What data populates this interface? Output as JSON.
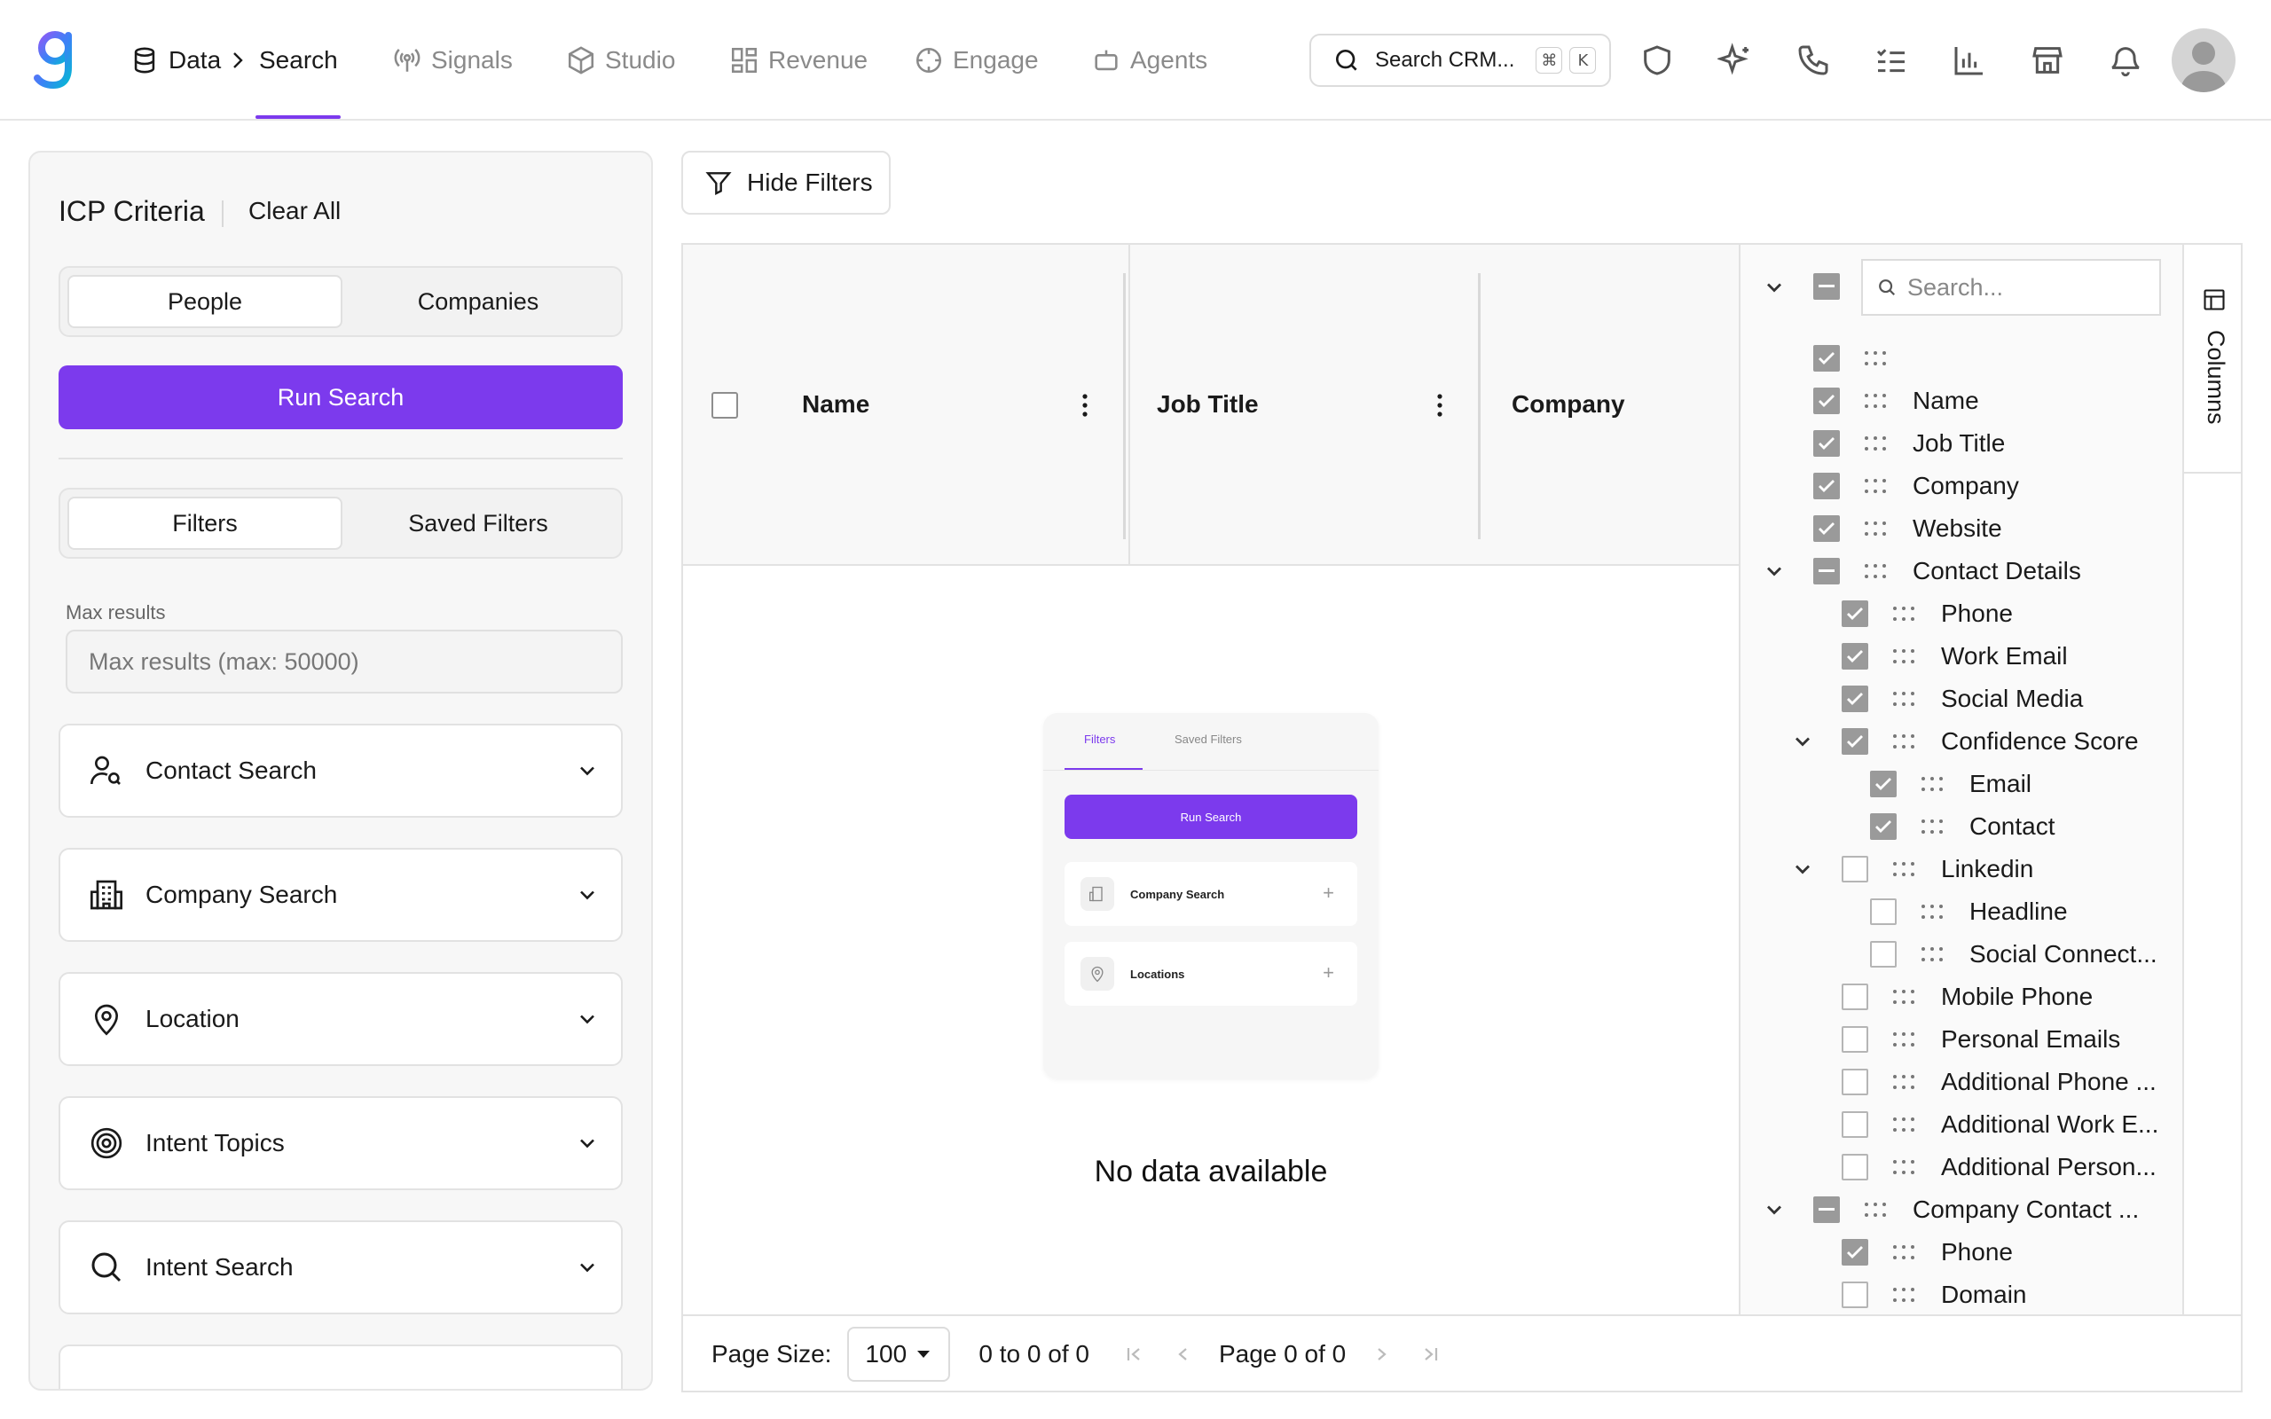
{
  "nav": {
    "data": "Data",
    "search": "Search",
    "signals": "Signals",
    "studio": "Studio",
    "revenue": "Revenue",
    "engage": "Engage",
    "agents": "Agents",
    "search_crm": "Search CRM...",
    "kbd_cmd": "⌘",
    "kbd_k": "K",
    "accent": "#7c3aed"
  },
  "left": {
    "title": "ICP Criteria",
    "clear_all": "Clear All",
    "tab_people": "People",
    "tab_companies": "Companies",
    "run_search": "Run Search",
    "tab_filters": "Filters",
    "tab_saved_filters": "Saved Filters",
    "max_results_label": "Max results",
    "max_results_placeholder": "Max results (max: 50000)",
    "sections": [
      "Contact Search",
      "Company Search",
      "Location",
      "Intent Topics",
      "Intent Search"
    ]
  },
  "main": {
    "hide_filters": "Hide Filters",
    "columns_head": [
      "Name",
      "Job Title",
      "Company"
    ],
    "no_data": "No data available",
    "illustration": {
      "tab_filters": "Filters",
      "tab_saved": "Saved Filters",
      "run": "Run Search",
      "card1": "Company Search",
      "card2": "Locations"
    },
    "pager": {
      "page_size_label": "Page Size:",
      "page_size": "100",
      "range": "0 to 0 of 0",
      "page": "Page 0 of 0"
    }
  },
  "columns_panel": {
    "tab_label": "Columns",
    "search_placeholder": "Search...",
    "items": [
      {
        "label": "",
        "state": "checked"
      },
      {
        "label": "Name",
        "state": "checked"
      },
      {
        "label": "Job Title",
        "state": "checked"
      },
      {
        "label": "Company",
        "state": "checked"
      },
      {
        "label": "Website",
        "state": "checked"
      },
      {
        "label": "Contact Details",
        "state": "mixed"
      },
      {
        "label": "Phone",
        "state": "checked"
      },
      {
        "label": "Work Email",
        "state": "checked"
      },
      {
        "label": "Social Media",
        "state": "checked"
      },
      {
        "label": "Confidence Score",
        "state": "checked"
      },
      {
        "label": "Email",
        "state": "checked"
      },
      {
        "label": "Contact",
        "state": "checked"
      },
      {
        "label": "Linkedin",
        "state": "unchecked"
      },
      {
        "label": "Headline",
        "state": "unchecked"
      },
      {
        "label": "Social Connect...",
        "state": "unchecked"
      },
      {
        "label": "Mobile Phone",
        "state": "unchecked"
      },
      {
        "label": "Personal Emails",
        "state": "unchecked"
      },
      {
        "label": "Additional Phone ...",
        "state": "unchecked"
      },
      {
        "label": "Additional Work E...",
        "state": "unchecked"
      },
      {
        "label": "Additional Person...",
        "state": "unchecked"
      },
      {
        "label": "Company Contact ...",
        "state": "mixed"
      },
      {
        "label": "Phone",
        "state": "checked"
      },
      {
        "label": "Domain",
        "state": "unchecked"
      }
    ]
  }
}
